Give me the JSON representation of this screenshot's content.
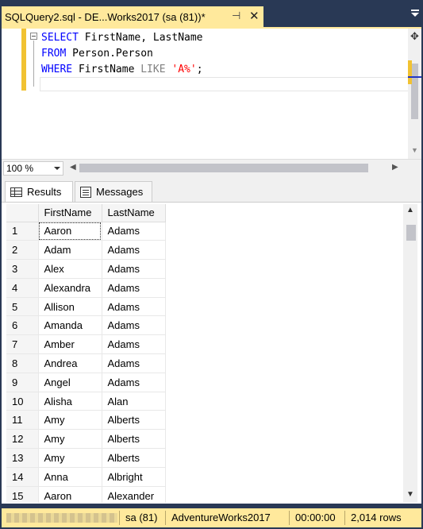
{
  "tab": {
    "title": "SQLQuery2.sql - DE...Works2017 (sa (81))*",
    "pin_icon": "pin-icon",
    "close_icon": "close-icon"
  },
  "editor": {
    "lines": [
      {
        "kw": "SELECT",
        "rest": " FirstName, LastName"
      },
      {
        "kw": "FROM",
        "rest": " Person.Person"
      },
      {
        "kw": "WHERE",
        "rest": " FirstName ",
        "op": "LIKE",
        "str": "'A%'",
        "end": ";"
      }
    ]
  },
  "zoom": {
    "value": "100 %"
  },
  "results_tabs": {
    "results": "Results",
    "messages": "Messages"
  },
  "grid": {
    "columns": [
      "",
      "FirstName",
      "LastName"
    ],
    "rows": [
      [
        "1",
        "Aaron",
        "Adams"
      ],
      [
        "2",
        "Adam",
        "Adams"
      ],
      [
        "3",
        "Alex",
        "Adams"
      ],
      [
        "4",
        "Alexandra",
        "Adams"
      ],
      [
        "5",
        "Allison",
        "Adams"
      ],
      [
        "6",
        "Amanda",
        "Adams"
      ],
      [
        "7",
        "Amber",
        "Adams"
      ],
      [
        "8",
        "Andrea",
        "Adams"
      ],
      [
        "9",
        "Angel",
        "Adams"
      ],
      [
        "10",
        "Alisha",
        "Alan"
      ],
      [
        "11",
        "Amy",
        "Alberts"
      ],
      [
        "12",
        "Amy",
        "Alberts"
      ],
      [
        "13",
        "Amy",
        "Alberts"
      ],
      [
        "14",
        "Anna",
        "Albright"
      ],
      [
        "15",
        "Aaron",
        "Alexander"
      ]
    ]
  },
  "status": {
    "user": "sa (81)",
    "database": "AdventureWorks2017",
    "elapsed": "00:00:00",
    "rows": "2,014 rows"
  },
  "colors": {
    "accent": "#ffe99c",
    "chrome": "#293955"
  }
}
